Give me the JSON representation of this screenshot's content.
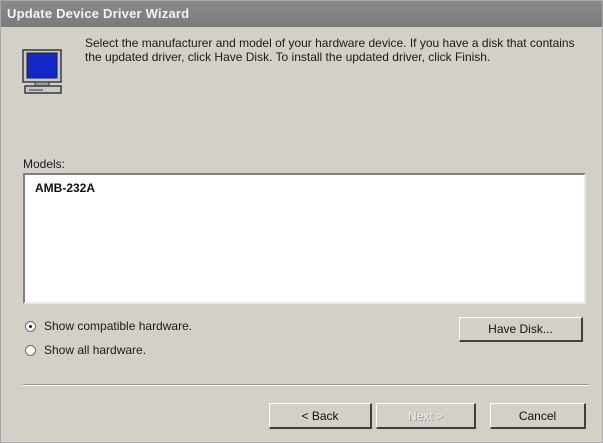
{
  "window": {
    "title": "Update Device Driver Wizard"
  },
  "description": "Select the manufacturer and model of your hardware device. If you have a disk that contains the updated driver, click Have Disk. To install the updated driver, click Finish.",
  "models": {
    "label": "Models:",
    "items": [
      "AMB-232A"
    ]
  },
  "options": {
    "show_compatible": {
      "label": "Show compatible hardware.",
      "checked": true
    },
    "show_all": {
      "label": "Show all hardware.",
      "checked": false
    }
  },
  "buttons": {
    "have_disk": "Have Disk...",
    "back": "< Back",
    "next": "Next >",
    "cancel": "Cancel"
  },
  "icons": {
    "monitor": "monitor-icon"
  },
  "colors": {
    "title_bar": "#7b7b7b",
    "dialog_face": "#d4d0c8",
    "monitor_screen": "#1428c8"
  }
}
